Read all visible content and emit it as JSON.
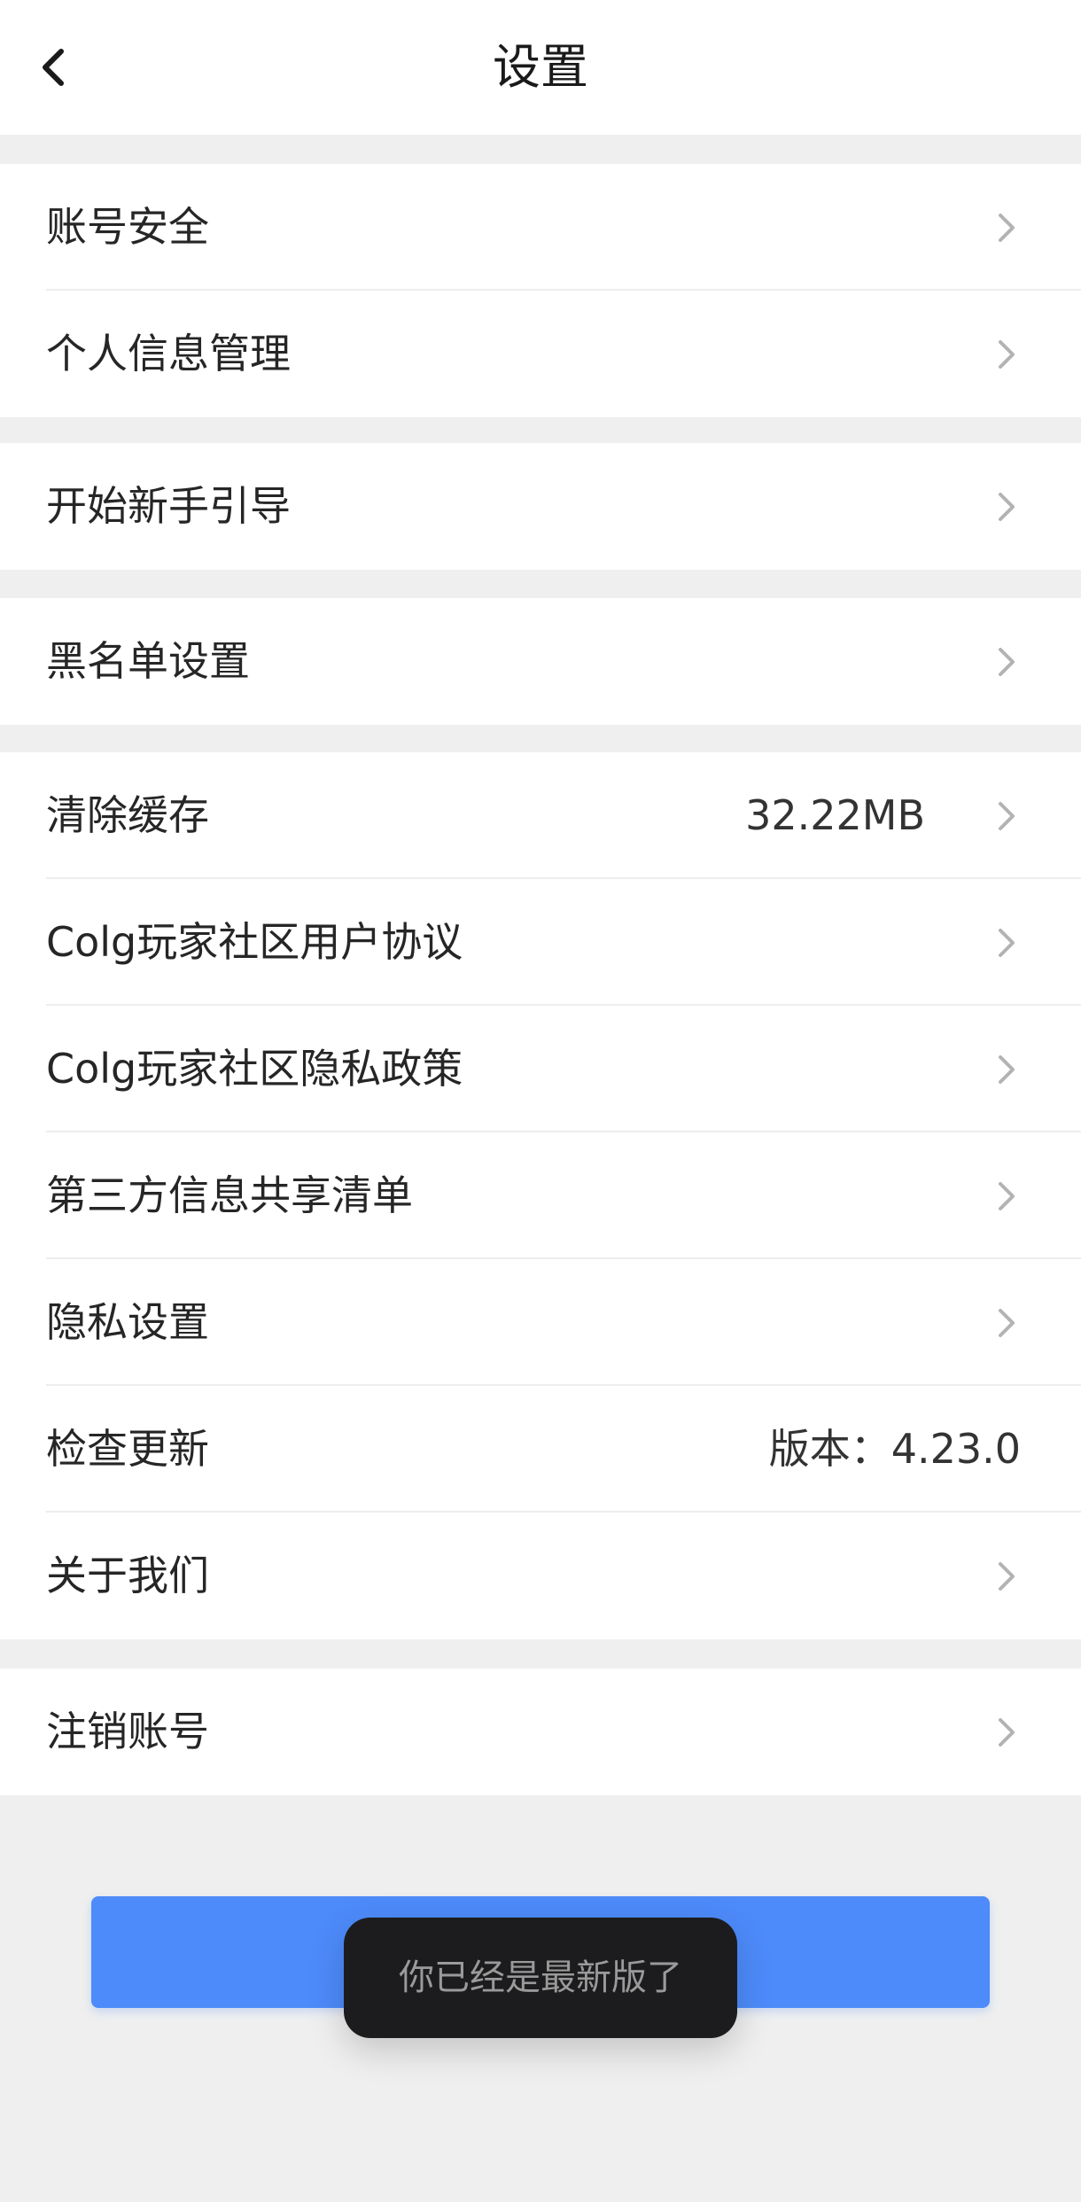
{
  "header": {
    "title": "设置",
    "back_icon": "chevron-left-icon"
  },
  "sections": [
    {
      "items": [
        {
          "label": "账号安全"
        },
        {
          "label": "个人信息管理"
        }
      ]
    },
    {
      "items": [
        {
          "label": "开始新手引导"
        }
      ]
    },
    {
      "items": [
        {
          "label": "黑名单设置"
        }
      ]
    },
    {
      "items": [
        {
          "label": "清除缓存",
          "value": "32.22MB"
        },
        {
          "label": "Colg玩家社区用户协议"
        },
        {
          "label": "Colg玩家社区隐私政策"
        },
        {
          "label": "第三方信息共享清单"
        },
        {
          "label": "隐私设置"
        },
        {
          "label": "检查更新",
          "value": "版本：4.23.0"
        },
        {
          "label": "关于我们"
        }
      ]
    },
    {
      "items": [
        {
          "label": "注销账号"
        }
      ]
    }
  ],
  "bottom_button": {
    "color": "#4d8bfa"
  },
  "toast": {
    "text": "你已经是最新版了"
  },
  "icons": {
    "row_arrow": "chevron-right-icon"
  }
}
